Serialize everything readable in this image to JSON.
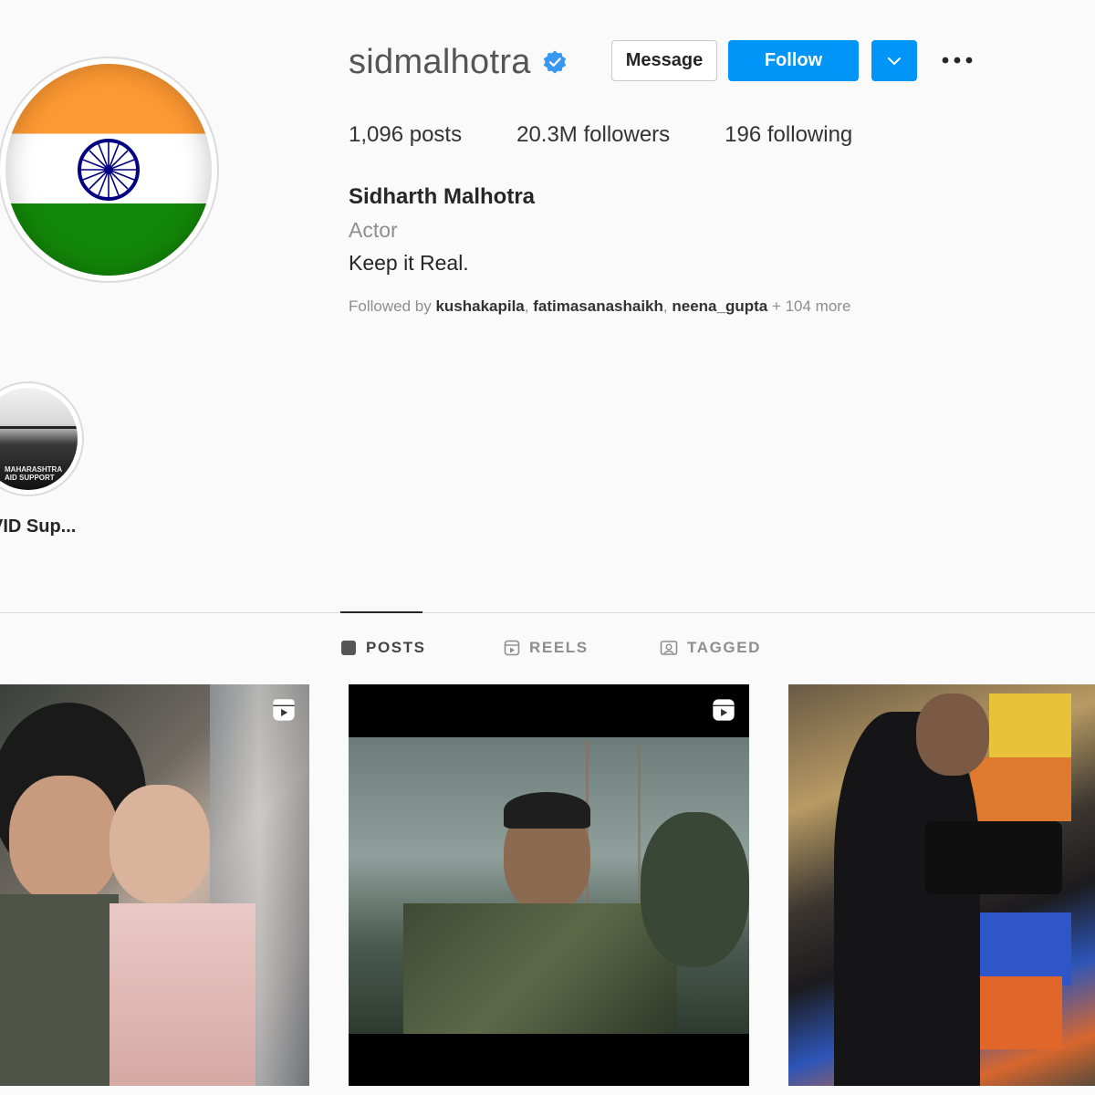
{
  "profile": {
    "username": "sidmalhotra",
    "verified": true,
    "full_name": "Sidharth Malhotra",
    "category": "Actor",
    "bio": "Keep it Real.",
    "followed_by_prefix": "Followed by ",
    "followed_by_users": [
      "kushakapila",
      "fatimasanashaikh",
      "neena_gupta"
    ],
    "followed_by_sep": ", ",
    "followed_by_suffix": " + 104 more"
  },
  "actions": {
    "message_label": "Message",
    "follow_label": "Follow"
  },
  "stats": {
    "posts_count": "1,096",
    "posts_label": " posts",
    "followers_count": "20.3M",
    "followers_label": " followers",
    "following_count": "196",
    "following_label": " following"
  },
  "highlights": [
    {
      "label": "VID Sup...",
      "caption_line1": "MAHARASHTRA",
      "caption_line2": "AID SUPPORT"
    }
  ],
  "tabs": [
    {
      "label": "POSTS",
      "icon": "grid-icon",
      "active": true
    },
    {
      "label": "REELS",
      "icon": "reels-icon",
      "active": false
    },
    {
      "label": "TAGGED",
      "icon": "tagged-icon",
      "active": false
    }
  ],
  "posts": [
    {
      "type": "reel",
      "icon": "reel-icon"
    },
    {
      "type": "reel",
      "icon": "reel-icon"
    },
    {
      "type": "image"
    }
  ],
  "colors": {
    "accent": "#0095f6",
    "verified": "#3897f0",
    "saffron": "#ff9933",
    "green": "#138808",
    "chakra": "#000080"
  }
}
